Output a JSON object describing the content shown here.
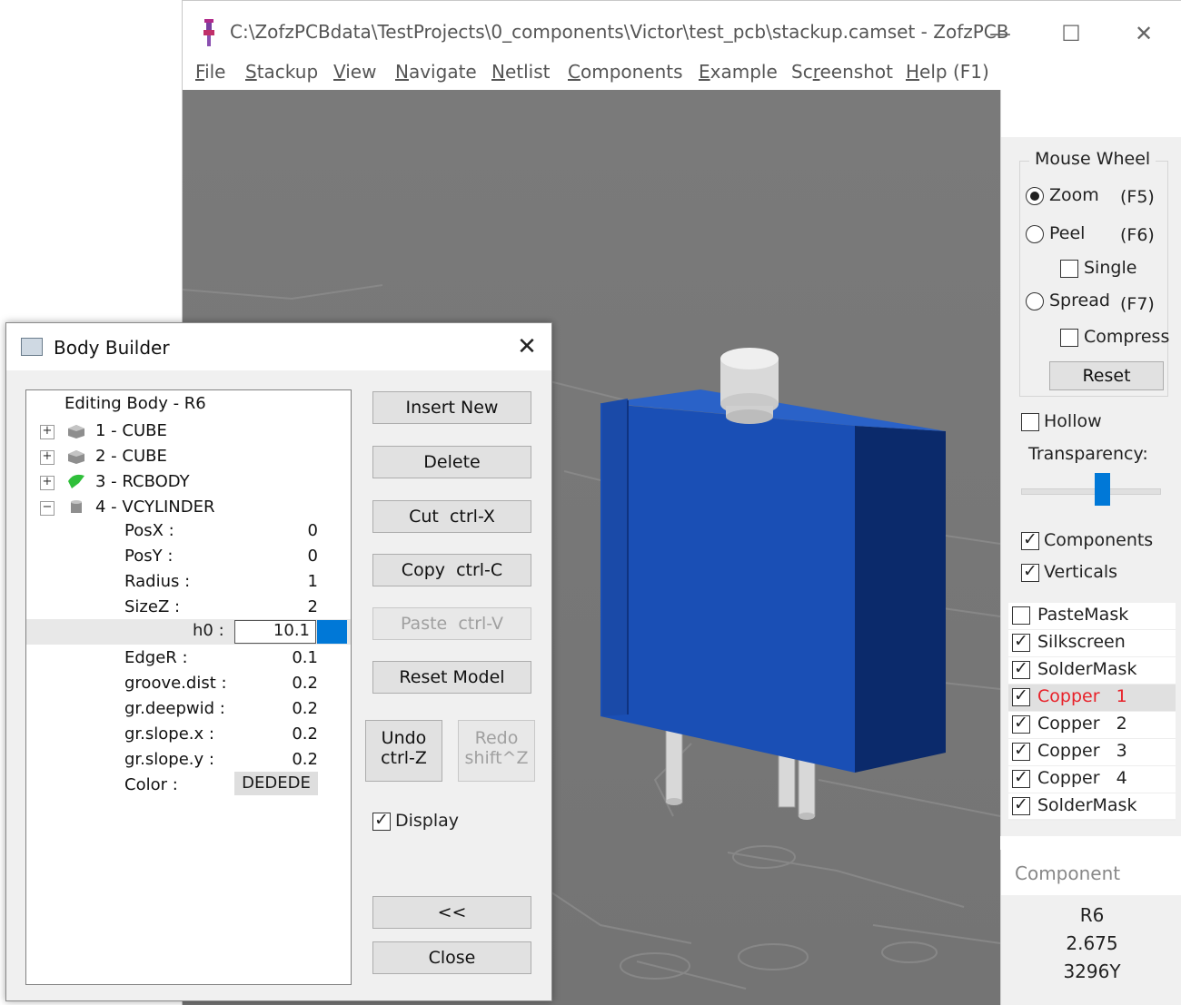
{
  "window": {
    "title": "C:\\ZofzPCBdata\\TestProjects\\0_components\\Victor\\test_pcb\\stackup.camset - ZofzPCB",
    "minimize": "—",
    "maximize": "☐",
    "close": "✕"
  },
  "menu": [
    {
      "u": "F",
      "rest": "ile"
    },
    {
      "u": "S",
      "rest": "tackup"
    },
    {
      "u": "V",
      "rest": "iew"
    },
    {
      "u": "N",
      "rest": "avigate"
    },
    {
      "u": "N",
      "rest": "etlist"
    },
    {
      "u": "C",
      "rest": "omponents"
    },
    {
      "u": "E",
      "rest": "xample"
    },
    {
      "pre": "Sc",
      "u": "r",
      "rest": "eenshot"
    },
    {
      "u": "H",
      "rest": "elp (F1)"
    }
  ],
  "mouse_wheel": {
    "legend": "Mouse Wheel",
    "zoom": "Zoom",
    "zoom_key": "(F5)",
    "peel": "Peel",
    "peel_key": "(F6)",
    "single": "Single",
    "spread": "Spread",
    "spread_key": "(F7)",
    "compress": "Compress",
    "reset": "Reset"
  },
  "view_options": {
    "hollow": "Hollow",
    "transparency_label": "Transparency:",
    "transparency_level": 0.6,
    "components": "Components",
    "verticals": "Verticals"
  },
  "layers": [
    {
      "name": "PasteMask",
      "checked": false
    },
    {
      "name": "Silkscreen",
      "checked": true
    },
    {
      "name": "SolderMask",
      "checked": true
    },
    {
      "name": "Copper   1",
      "checked": true,
      "selected": true,
      "color": "#e8222a"
    },
    {
      "name": "Copper   2",
      "checked": true
    },
    {
      "name": "Copper   3",
      "checked": true
    },
    {
      "name": "Copper   4",
      "checked": true
    },
    {
      "name": "SolderMask",
      "checked": true
    }
  ],
  "component": {
    "header": "Component",
    "name": "R6",
    "value": "2.675",
    "part": "3296Y"
  },
  "dialog": {
    "title": "Body Builder",
    "close": "✕",
    "tree": {
      "root": "Editing Body - R6",
      "nodes": [
        {
          "label": "1 - CUBE",
          "expander": "+"
        },
        {
          "label": "2 - CUBE",
          "expander": "+"
        },
        {
          "label": "3 - RCBODY",
          "expander": "+"
        },
        {
          "label": "4 - VCYLINDER",
          "expander": "−"
        }
      ],
      "props": [
        {
          "name": "PosX :",
          "value": "0"
        },
        {
          "name": "PosY :",
          "value": "0"
        },
        {
          "name": "Radius :",
          "value": "1"
        },
        {
          "name": "SizeZ :",
          "value": "2"
        },
        {
          "name": "h0 :",
          "value": "10.1"
        },
        {
          "name": "EdgeR :",
          "value": "0.1"
        },
        {
          "name": "groove.dist :",
          "value": "0.2"
        },
        {
          "name": "gr.deepwid :",
          "value": "0.2"
        },
        {
          "name": "gr.slope.x :",
          "value": "0.2"
        },
        {
          "name": "gr.slope.y :",
          "value": "0.2"
        },
        {
          "name": "Color :",
          "value": "DEDEDE"
        }
      ]
    },
    "buttons": {
      "insert_new": "Insert New",
      "delete": "Delete",
      "cut": "Cut  ctrl-X",
      "copy": "Copy  ctrl-C",
      "paste": "Paste  ctrl-V",
      "reset_model": "Reset Model",
      "undo_1": "Undo",
      "undo_2": "ctrl-Z",
      "redo_1": "Redo",
      "redo_2": "shift^Z",
      "display": "Display",
      "collapse": "<<",
      "close": "Close"
    }
  },
  "colors": {
    "body_blue": "#1a4fb5",
    "accent": "#0078d7",
    "viewport_gray": "#7b7b7b"
  }
}
